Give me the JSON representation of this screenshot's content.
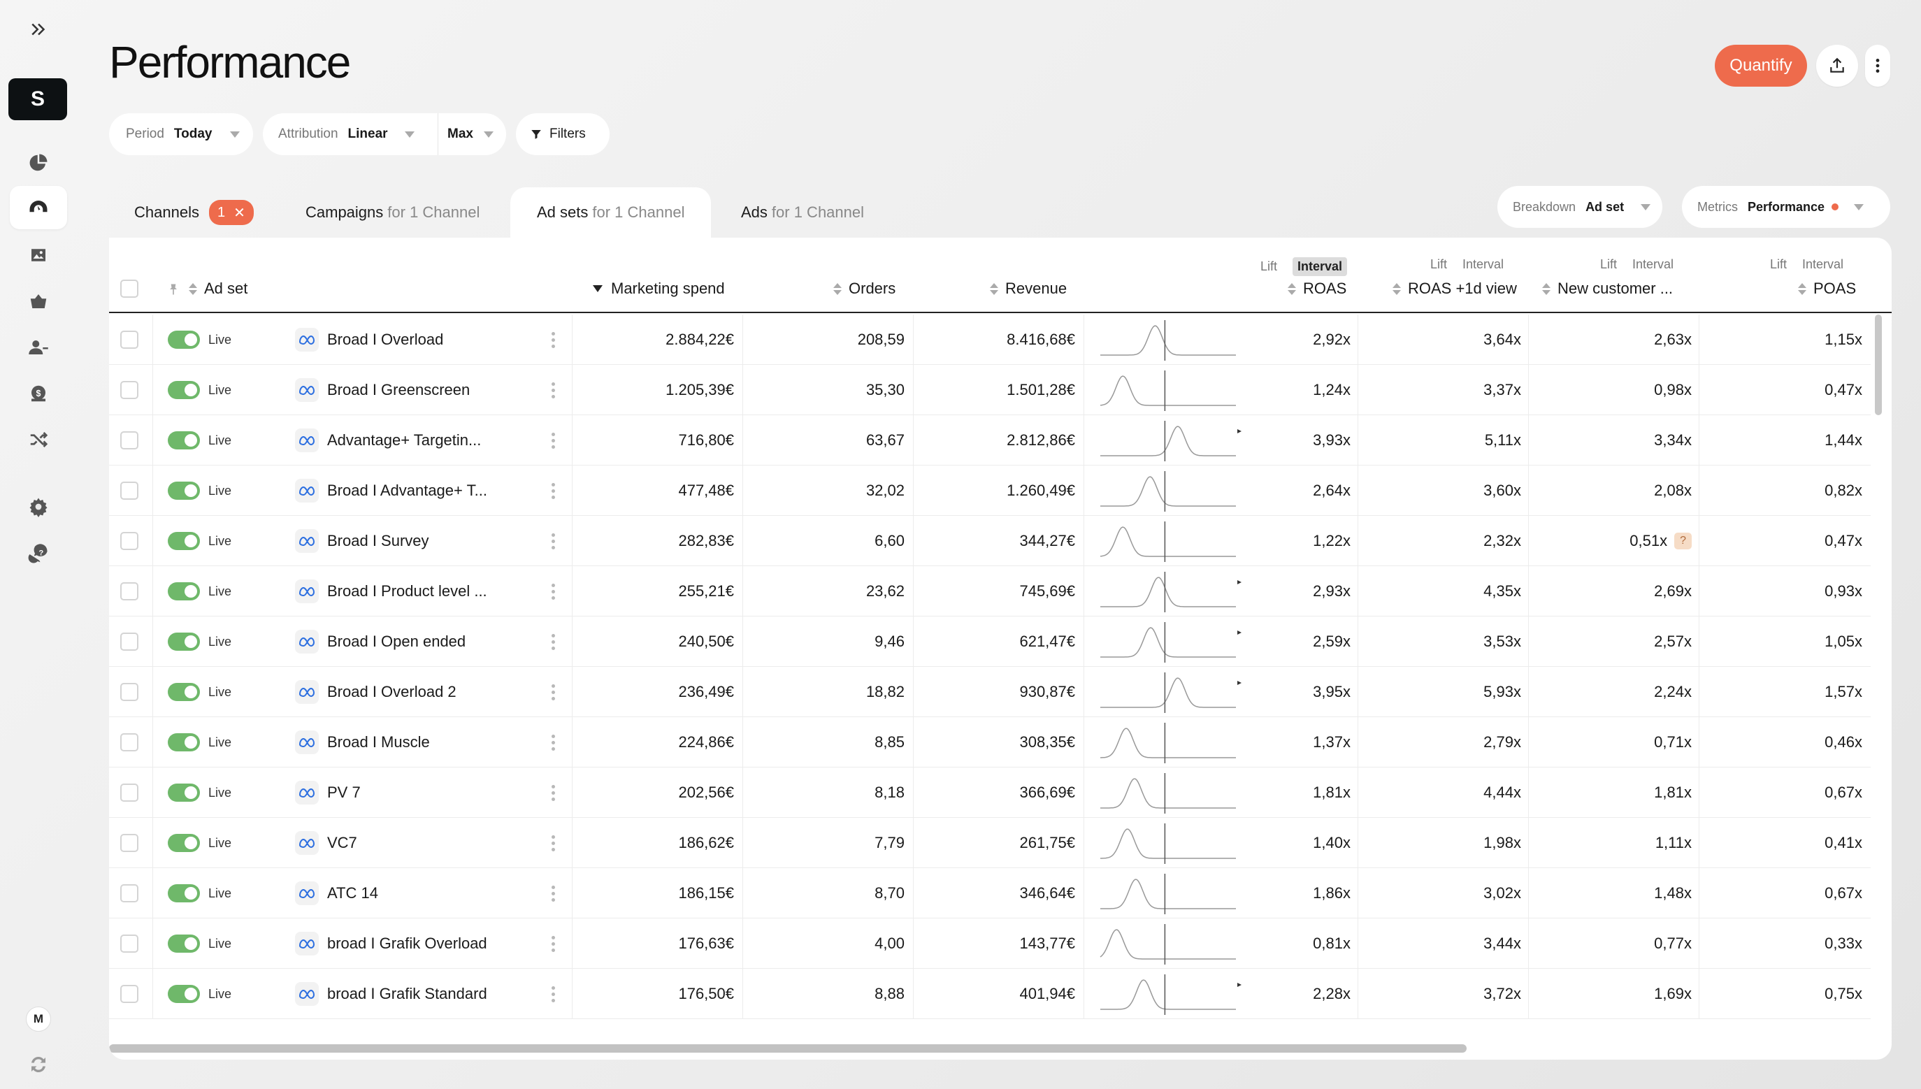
{
  "page": {
    "title": "Performance"
  },
  "header": {
    "quantify_label": "Quantify"
  },
  "workspace": {
    "initial": "S"
  },
  "user": {
    "initial": "M"
  },
  "sidebar": {
    "items": [
      {
        "name": "overview-icon"
      },
      {
        "name": "performance-icon"
      },
      {
        "name": "creatives-icon"
      },
      {
        "name": "products-icon"
      },
      {
        "name": "customers-icon"
      },
      {
        "name": "finance-icon"
      },
      {
        "name": "shuffle-icon"
      },
      {
        "name": "settings-icon"
      },
      {
        "name": "help-icon"
      }
    ]
  },
  "filters": {
    "period": {
      "label": "Period",
      "value": "Today"
    },
    "attribution": {
      "label": "Attribution",
      "value": "Linear"
    },
    "window": {
      "value": "Max"
    },
    "filters_label": "Filters"
  },
  "tabs": [
    {
      "label": "Channels",
      "badge": "1"
    },
    {
      "label": "Campaigns",
      "sub": "for 1 Channel"
    },
    {
      "label": "Ad sets",
      "sub": "for 1 Channel"
    },
    {
      "label": "Ads",
      "sub": "for 1 Channel"
    }
  ],
  "breakdown": {
    "label": "Breakdown",
    "value": "Ad set"
  },
  "metrics": {
    "label": "Metrics",
    "value": "Performance"
  },
  "table": {
    "columns": {
      "adset": "Ad set",
      "spend": "Marketing spend",
      "orders": "Orders",
      "revenue": "Revenue",
      "roas": "ROAS",
      "roas1d": "ROAS +1d view",
      "newcust": "New customer ...",
      "poas": "POAS"
    },
    "lift_label": "Lift",
    "interval_label": "Interval",
    "status_label": "Live",
    "rows": [
      {
        "name": "Broad I Overload",
        "spend": "2.884,22€",
        "orders": "208,59",
        "revenue": "8.416,68€",
        "roas": "2,92x",
        "roas1d": "3,64x",
        "newcust": "2,63x",
        "poas": "1,15x",
        "peak": 0.85,
        "arrow": false
      },
      {
        "name": "Broad I Greenscreen",
        "spend": "1.205,39€",
        "orders": "35,30",
        "revenue": "1.501,28€",
        "roas": "1,24x",
        "roas1d": "3,37x",
        "newcust": "0,98x",
        "poas": "0,47x",
        "peak": 0.35,
        "arrow": false
      },
      {
        "name": "Advantage+ Targetin...",
        "spend": "716,80€",
        "orders": "63,67",
        "revenue": "2.812,86€",
        "roas": "3,93x",
        "roas1d": "5,11x",
        "newcust": "3,34x",
        "poas": "1,44x",
        "peak": 1.2,
        "arrow": true
      },
      {
        "name": "Broad I Advantage+ T...",
        "spend": "477,48€",
        "orders": "32,02",
        "revenue": "1.260,49€",
        "roas": "2,64x",
        "roas1d": "3,60x",
        "newcust": "2,08x",
        "poas": "0,82x",
        "peak": 0.77,
        "arrow": false
      },
      {
        "name": "Broad I Survey",
        "spend": "282,83€",
        "orders": "6,60",
        "revenue": "344,27€",
        "roas": "1,22x",
        "roas1d": "2,32x",
        "newcust": "0,51x",
        "newcust_flag": "?",
        "poas": "0,47x",
        "peak": 0.35,
        "arrow": false
      },
      {
        "name": "Broad I Product level ...",
        "spend": "255,21€",
        "orders": "23,62",
        "revenue": "745,69€",
        "roas": "2,93x",
        "roas1d": "4,35x",
        "newcust": "2,69x",
        "poas": "0,93x",
        "peak": 0.9,
        "arrow": true
      },
      {
        "name": "Broad I Open ended",
        "spend": "240,50€",
        "orders": "9,46",
        "revenue": "621,47€",
        "roas": "2,59x",
        "roas1d": "3,53x",
        "newcust": "2,57x",
        "poas": "1,05x",
        "peak": 0.78,
        "arrow": true
      },
      {
        "name": "Broad I Overload 2",
        "spend": "236,49€",
        "orders": "18,82",
        "revenue": "930,87€",
        "roas": "3,95x",
        "roas1d": "5,93x",
        "newcust": "2,24x",
        "poas": "1,57x",
        "peak": 1.2,
        "arrow": true
      },
      {
        "name": "Broad I Muscle",
        "spend": "224,86€",
        "orders": "8,85",
        "revenue": "308,35€",
        "roas": "1,37x",
        "roas1d": "2,79x",
        "newcust": "0,71x",
        "poas": "0,46x",
        "peak": 0.4,
        "arrow": false
      },
      {
        "name": "PV 7",
        "spend": "202,56€",
        "orders": "8,18",
        "revenue": "366,69€",
        "roas": "1,81x",
        "roas1d": "4,44x",
        "newcust": "1,81x",
        "poas": "0,67x",
        "peak": 0.53,
        "arrow": false
      },
      {
        "name": "VC7",
        "spend": "186,62€",
        "orders": "7,79",
        "revenue": "261,75€",
        "roas": "1,40x",
        "roas1d": "1,98x",
        "newcust": "1,11x",
        "poas": "0,41x",
        "peak": 0.42,
        "arrow": false
      },
      {
        "name": "ATC 14",
        "spend": "186,15€",
        "orders": "8,70",
        "revenue": "346,64€",
        "roas": "1,86x",
        "roas1d": "3,02x",
        "newcust": "1,48x",
        "poas": "0,67x",
        "peak": 0.55,
        "arrow": false
      },
      {
        "name": "broad I Grafik Overload",
        "spend": "176,63€",
        "orders": "4,00",
        "revenue": "143,77€",
        "roas": "0,81x",
        "roas1d": "3,44x",
        "newcust": "0,77x",
        "poas": "0,33x",
        "peak": 0.25,
        "arrow": false
      },
      {
        "name": "broad I Grafik Standard",
        "spend": "176,50€",
        "orders": "8,88",
        "revenue": "401,94€",
        "roas": "2,28x",
        "roas1d": "3,72x",
        "newcust": "1,69x",
        "poas": "0,75x",
        "peak": 0.67,
        "arrow": true
      }
    ]
  }
}
